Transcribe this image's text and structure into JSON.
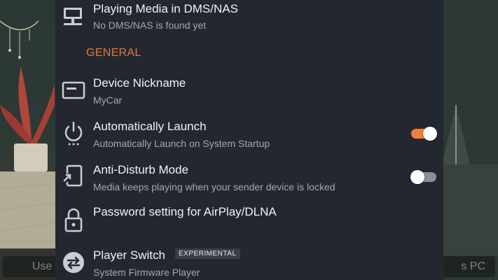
{
  "background": {
    "bar_left_text": "Use",
    "bar_right_text": "s PC"
  },
  "colors": {
    "accent": "#e2773e",
    "panel": "#232830",
    "toggle_on": "#ef7f3a",
    "toggle_off": "#8a8f97"
  },
  "settings": {
    "dms": {
      "icon": "computer-network-icon",
      "title": "Playing Media in DMS/NAS",
      "subtitle": "No DMS/NAS is found yet"
    },
    "section_general": "GENERAL",
    "nickname": {
      "icon": "card-icon",
      "title": "Device Nickname",
      "subtitle": "MyCar"
    },
    "auto_launch": {
      "icon": "power-icon",
      "title": "Automatically Launch",
      "subtitle": "Automatically Launch on System Startup",
      "enabled": true
    },
    "anti_disturb": {
      "icon": "lock-screen-icon",
      "title": "Anti-Disturb Mode",
      "subtitle": "Media keeps playing when your sender device is locked",
      "enabled": false
    },
    "password": {
      "icon": "lock-icon",
      "title": "Password setting for AirPlay/DLNA"
    },
    "player_switch": {
      "icon": "switch-arrows-icon",
      "title": "Player Switch",
      "badge": "EXPERIMENTAL",
      "subtitle": "System Firmware Player"
    }
  }
}
